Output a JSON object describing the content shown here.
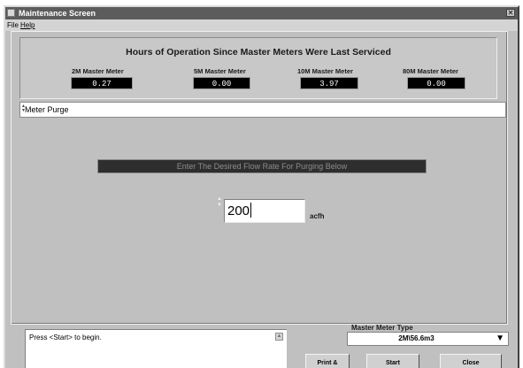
{
  "window": {
    "title": "Maintenance Screen",
    "close_glyph": "✕"
  },
  "menu": {
    "file": "File",
    "help": "Help"
  },
  "hours": {
    "title": "Hours of Operation Since Master Meters Were Last Serviced",
    "meters": [
      {
        "label": "2M Master Meter",
        "value": "0.27"
      },
      {
        "label": "5M Master Meter",
        "value": "0.00"
      },
      {
        "label": "10M Master Meter",
        "value": "3.97"
      },
      {
        "label": "80M Master Meter",
        "value": "0.00"
      }
    ]
  },
  "purge": {
    "label": "Meter Purge"
  },
  "flow": {
    "banner": "Enter The Desired Flow Rate For Purging Below",
    "value": "200",
    "unit": "acfh"
  },
  "status": {
    "message": "Press <Start> to begin."
  },
  "meter_type": {
    "label": "Master Meter Type",
    "selected": "2M\\56.6m3"
  },
  "buttons": {
    "print": "Print &",
    "start": "Start",
    "close": "Close"
  },
  "colors": {
    "window_bg": "#c0c0c0",
    "titlebar": "#5c5c5c",
    "display_bg": "#000000",
    "banner_bg": "#2e2e2e"
  }
}
